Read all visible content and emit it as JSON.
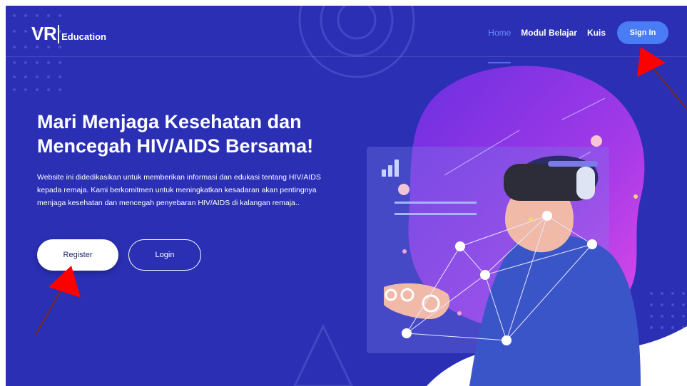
{
  "brand": {
    "logo_main": "VR",
    "logo_sub": "Education"
  },
  "nav": {
    "items": [
      {
        "label": "Home",
        "active": true
      },
      {
        "label": "Modul Belajar",
        "active": false
      },
      {
        "label": "Kuis",
        "active": false
      }
    ],
    "signin_label": "Sign In"
  },
  "hero": {
    "title": "Mari Menjaga Kesehatan dan Mencegah HIV/AIDS Bersama!",
    "description": "Website ini didedikasikan untuk memberikan informasi dan edukasi tentang HIV/AIDS kepada remaja. Kami berkomitmen untuk meningkatkan kesadaran akan pentingnya menjaga kesehatan dan mencegah penyebaran HIV/AIDS di kalangan remaja..",
    "register_label": "Register",
    "login_label": "Login"
  },
  "colors": {
    "background": "#2a2fb4",
    "accent": "#4a7cf5",
    "annotation_arrow": "#ff0000"
  },
  "illustration": {
    "icons": [
      "vr-headset-person-illustration",
      "network-nodes",
      "bar-chart-icon"
    ]
  }
}
